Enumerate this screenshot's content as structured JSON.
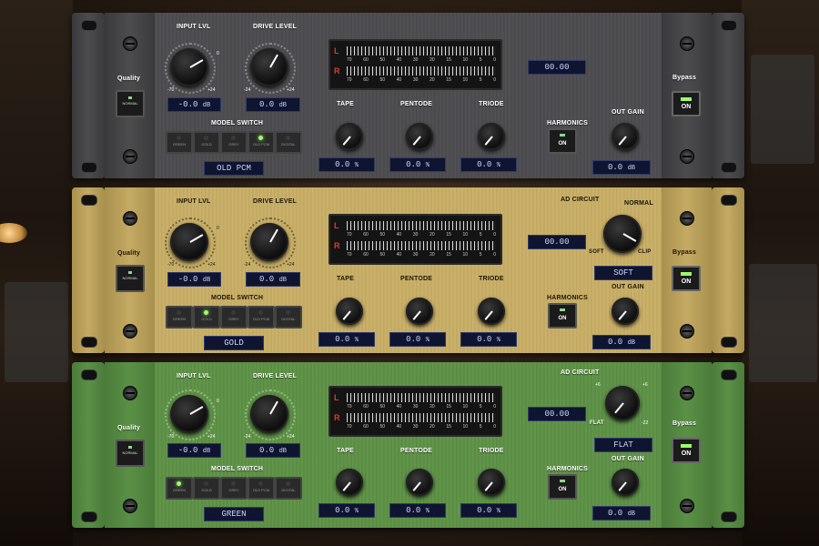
{
  "colors": {
    "meter_label": "#e23b2a",
    "led_on": "#9cff6a",
    "display_bg": "#0f1530"
  },
  "units": [
    {
      "theme": "dark",
      "labels": {
        "input_lvl": "INPUT LVL",
        "drive_level": "DRIVE LEVEL",
        "model_switch": "MODEL SWITCH",
        "tape": "TAPE",
        "pentode": "PENTODE",
        "triode": "TRIODE",
        "harmonics": "HARMONICS",
        "out_gain": "OUT GAIN",
        "quality": "Quality",
        "bypass": "Bypass"
      },
      "input_value": "-0.0",
      "input_unit": "dB",
      "drive_value": "0.0",
      "drive_unit": "dB",
      "meter_value": "00.00",
      "tape_value": "0.0",
      "pentode_value": "0.0",
      "triode_value": "0.0",
      "pct": "%",
      "out_value": "0.0",
      "out_unit": "dB",
      "model_value": "OLD PCM",
      "quality_btn": "NORMAL",
      "harmonics_btn": "ON",
      "bypass_btn": "ON",
      "models": [
        "GREEN",
        "GOLD",
        "GREY",
        "OLD PCM",
        "DIGITAL"
      ],
      "active_model": 3
    },
    {
      "theme": "gold",
      "labels": {
        "input_lvl": "INPUT LVL",
        "drive_level": "DRIVE LEVEL",
        "model_switch": "MODEL SWITCH",
        "tape": "TAPE",
        "pentode": "PENTODE",
        "triode": "TRIODE",
        "harmonics": "HARMONICS",
        "out_gain": "OUT GAIN",
        "quality": "Quality",
        "bypass": "Bypass",
        "ad_circuit": "AD CIRCUIT",
        "normal": "NORMAL",
        "soft": "SOFT",
        "clip": "CLIP"
      },
      "input_value": "-0.0",
      "input_unit": "dB",
      "drive_value": "0.0",
      "drive_unit": "dB",
      "meter_value": "00.00",
      "ad_value": "SOFT",
      "tape_value": "0.0",
      "pentode_value": "0.0",
      "triode_value": "0.0",
      "pct": "%",
      "out_value": "0.0",
      "out_unit": "dB",
      "model_value": "GOLD",
      "quality_btn": "NORMAL",
      "harmonics_btn": "ON",
      "bypass_btn": "ON",
      "models": [
        "GREEN",
        "GOLD",
        "GREY",
        "OLD PCM",
        "DIGITAL"
      ],
      "active_model": 1
    },
    {
      "theme": "green",
      "labels": {
        "input_lvl": "INPUT LVL",
        "drive_level": "DRIVE LEVEL",
        "model_switch": "MODEL SWITCH",
        "tape": "TAPE",
        "pentode": "PENTODE",
        "triode": "TRIODE",
        "harmonics": "HARMONICS",
        "out_gain": "OUT GAIN",
        "quality": "Quality",
        "bypass": "Bypass",
        "ad_circuit": "AD CIRCUIT",
        "flat": "FLAT"
      },
      "input_value": "-0.0",
      "input_unit": "dB",
      "drive_value": "0.0",
      "drive_unit": "dB",
      "meter_value": "00.00",
      "ad_value": "FLAT",
      "tape_value": "0.0",
      "pentode_value": "0.0",
      "triode_value": "0.0",
      "pct": "%",
      "out_value": "0.0",
      "out_unit": "dB",
      "model_value": "GREEN",
      "quality_btn": "NORMAL",
      "harmonics_btn": "ON",
      "bypass_btn": "ON",
      "models": [
        "GREEN",
        "GOLD",
        "GREY",
        "OLD PCM",
        "DIGITAL"
      ],
      "active_model": 0
    }
  ],
  "meter": {
    "left": "L",
    "right": "R",
    "scale": [
      "70",
      "60",
      "50",
      "40",
      "30",
      "20",
      "15",
      "10",
      "5",
      "0"
    ]
  },
  "knob_ticks": {
    "min_input": "-70",
    "max_input": "+24",
    "min_drive": "-24",
    "max_drive": "+24",
    "mid": "0"
  }
}
